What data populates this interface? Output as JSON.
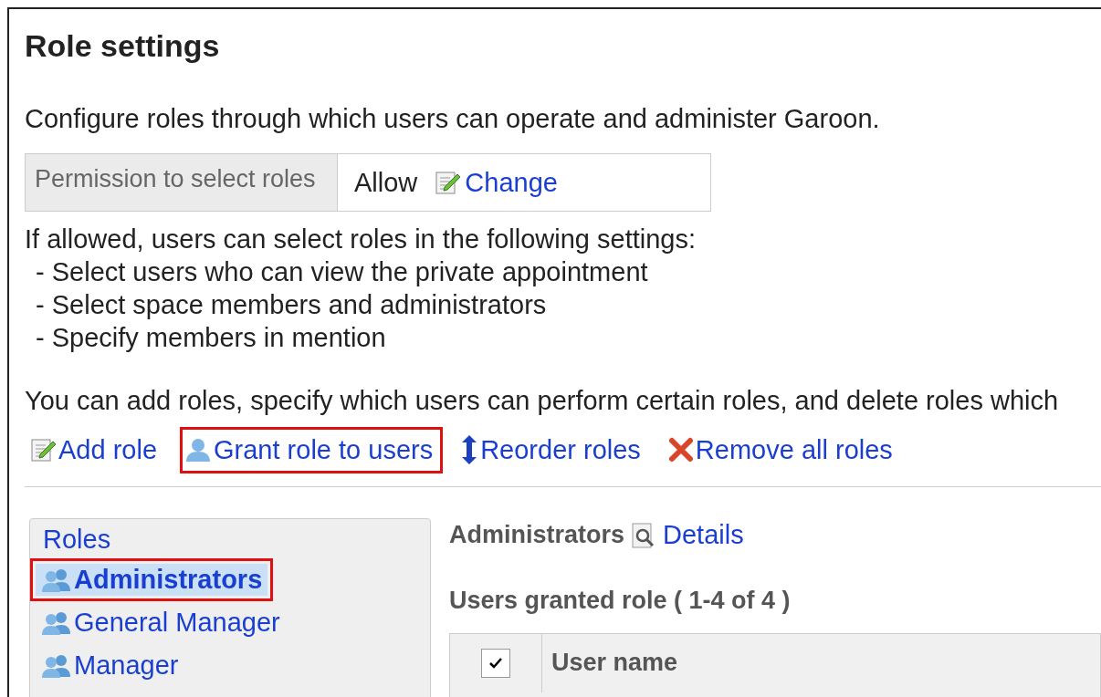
{
  "page": {
    "title": "Role settings",
    "description": "Configure roles through which users can operate and administer Garoon."
  },
  "permission": {
    "label": "Permission to select roles",
    "value": "Allow",
    "action": "Change"
  },
  "notes": {
    "intro": "If allowed, users can select roles in the following settings:",
    "items": [
      "- Select users who can view the private appointment",
      "- Select space members and administrators",
      "- Specify members in mention"
    ]
  },
  "instructions": "You can add roles, specify which users can perform certain roles, and delete roles which",
  "actions": [
    {
      "kind": "edit",
      "label": "Add role",
      "highlighted": false
    },
    {
      "kind": "user",
      "label": "Grant role to users",
      "highlighted": true
    },
    {
      "kind": "reorder",
      "label": "Reorder roles",
      "highlighted": false
    },
    {
      "kind": "remove",
      "label": "Remove all roles",
      "highlighted": false
    }
  ],
  "roles_panel": {
    "title": "Roles",
    "items": [
      {
        "label": "Administrators",
        "selected": true,
        "highlighted": true
      },
      {
        "label": "General Manager",
        "selected": false,
        "highlighted": false
      },
      {
        "label": "Manager",
        "selected": false,
        "highlighted": false
      }
    ]
  },
  "detail": {
    "role": "Administrators",
    "details_link": "Details",
    "users_heading": "Users granted role ( 1-4 of 4 )",
    "table": {
      "select_all_checked": true,
      "columns": [
        "User name"
      ]
    }
  }
}
